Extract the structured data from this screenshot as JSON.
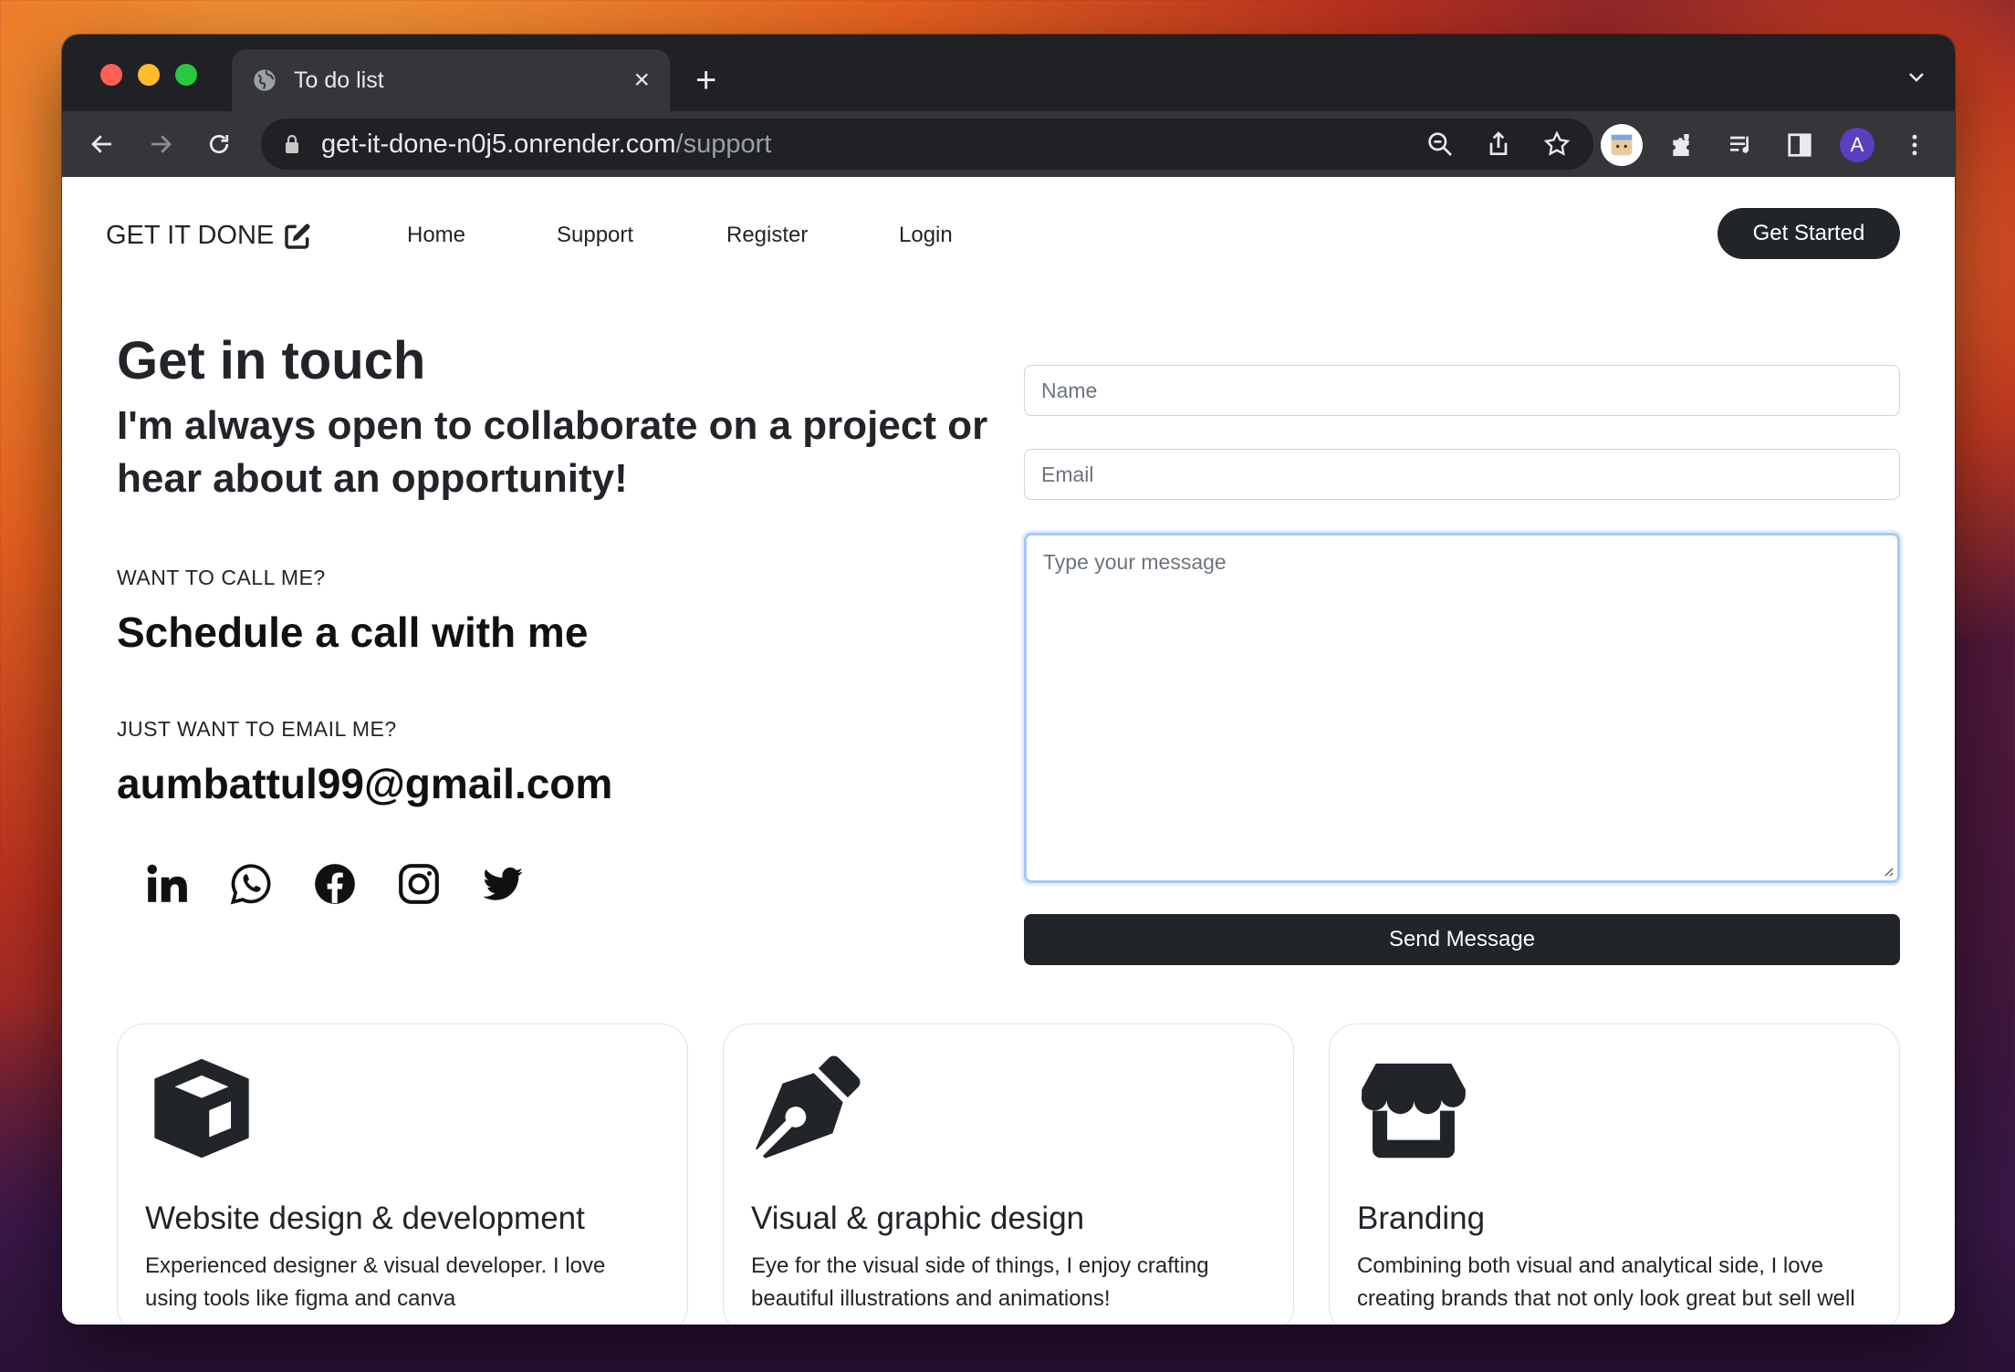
{
  "browser": {
    "tab_title": "To do list",
    "new_tab_label": "+",
    "url_host": "get-it-done-n0j5.onrender.com",
    "url_path": "/support",
    "profile_initial": "A"
  },
  "navbar": {
    "brand": "GET IT DONE",
    "links": [
      "Home",
      "Support",
      "Register",
      "Login"
    ],
    "cta": "Get Started"
  },
  "contact": {
    "heading": "Get in touch",
    "subheading": "I'm always open to collaborate on a project or hear about an opportunity!",
    "call_label": "WANT TO CALL ME?",
    "call_heading": "Schedule a call with me",
    "email_label": "JUST WANT TO EMAIL ME?",
    "email": "aumbattul99@gmail.com",
    "socials": [
      "linkedin-icon",
      "whatsapp-icon",
      "facebook-icon",
      "instagram-icon",
      "twitter-icon"
    ]
  },
  "form": {
    "name_placeholder": "Name",
    "email_placeholder": "Email",
    "message_placeholder": "Type your message",
    "submit": "Send Message"
  },
  "services": [
    {
      "icon": "box-icon",
      "title": "Website design & development",
      "description": "Experienced designer & visual developer. I love using tools like figma and canva"
    },
    {
      "icon": "pen-nib-icon",
      "title": "Visual & graphic design",
      "description": "Eye for the visual side of things, I enjoy crafting beautiful illustrations and animations!"
    },
    {
      "icon": "shop-icon",
      "title": "Branding",
      "description": "Combining both visual and analytical side, I love creating brands that not only look great but sell well"
    }
  ],
  "colors": {
    "dark": "#212529",
    "focus_border": "#a6c8f7",
    "chrome_dark": "#202124",
    "chrome_tab": "#35363a"
  }
}
